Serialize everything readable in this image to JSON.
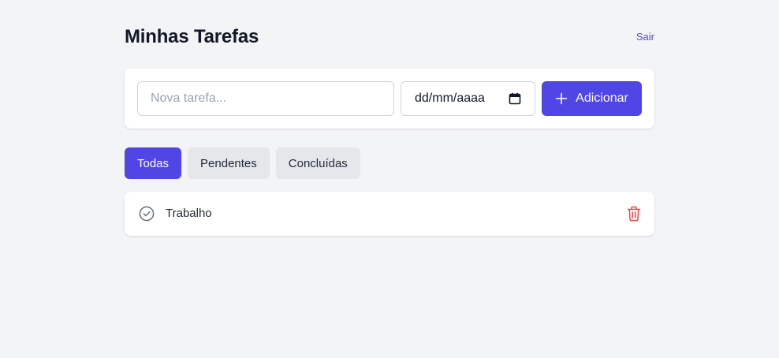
{
  "header": {
    "title": "Minhas Tarefas",
    "logout_label": "Sair"
  },
  "add_form": {
    "task_placeholder": "Nova tarefa...",
    "task_value": "",
    "date_placeholder": "dd/mm/aaaa",
    "add_label": "Adicionar",
    "icons": {
      "date": "calendar-icon",
      "add": "plus-icon"
    }
  },
  "filters": [
    {
      "label": "Todas",
      "active": true
    },
    {
      "label": "Pendentes",
      "active": false
    },
    {
      "label": "Concluídas",
      "active": false
    }
  ],
  "tasks": [
    {
      "title": "Trabalho",
      "completed": false,
      "icons": {
        "toggle": "check-circle-icon",
        "delete": "trash-icon"
      }
    }
  ],
  "colors": {
    "accent": "#4f46e5",
    "background": "#f3f4f6",
    "danger": "#ef4444"
  }
}
